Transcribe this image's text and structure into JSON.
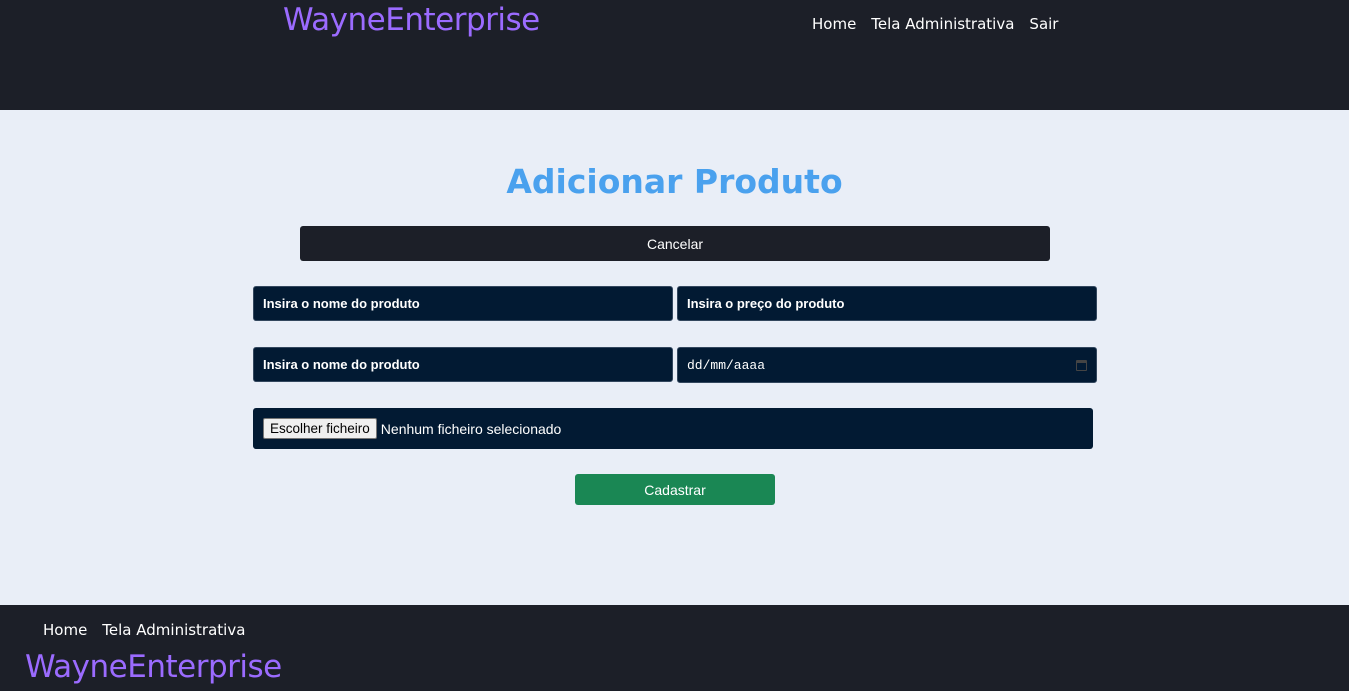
{
  "header": {
    "brand": "WayneEnterprise",
    "nav": [
      "Home",
      "Tela Administrativa",
      "Sair"
    ]
  },
  "main": {
    "title": "Adicionar Produto",
    "cancel_label": "Cancelar",
    "fields": {
      "name_placeholder": "Insira o nome do produto",
      "price_placeholder": "Insira o preço do produto",
      "name2_placeholder": "Insira o nome do produto",
      "date_placeholder": "dd/mm/aaaa"
    },
    "file": {
      "button_label": "Escolher ficheiro",
      "status": "Nenhum ficheiro selecionado"
    },
    "submit_label": "Cadastrar"
  },
  "footer": {
    "nav": [
      "Home",
      "Tela Administrativa"
    ],
    "brand": "WayneEnterprise"
  },
  "colors": {
    "header_bg": "#1c1f28",
    "brand": "#9b6bff",
    "title": "#4aa1ee",
    "field_bg": "#021a33",
    "submit": "#1a8754",
    "page_bg": "#e9eef7"
  }
}
